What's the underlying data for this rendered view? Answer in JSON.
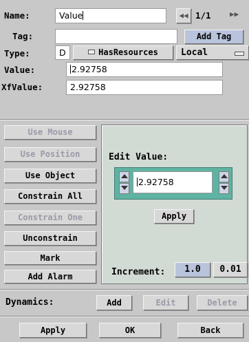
{
  "name": {
    "label": "Name:",
    "value": "Value",
    "pager": "1/1"
  },
  "tag": {
    "label": "Tag:",
    "value": "",
    "add_button": "Add Tag"
  },
  "type": {
    "label": "Type:",
    "code": "D",
    "resources_toggle": "HasResources",
    "scope_select": "Local"
  },
  "value": {
    "label": "Value:",
    "value": "2.92758"
  },
  "xfvalue": {
    "label": "XfValue:",
    "value": "2.92758"
  },
  "side_buttons": [
    {
      "label": "Use Mouse",
      "enabled": false
    },
    {
      "label": "Use Position",
      "enabled": false
    },
    {
      "label": "Use Object",
      "enabled": true
    },
    {
      "label": "Constrain All",
      "enabled": true
    },
    {
      "label": "Constrain One",
      "enabled": false
    },
    {
      "label": "Unconstrain",
      "enabled": true
    },
    {
      "label": "Mark",
      "enabled": true
    },
    {
      "label": "Add Alarm",
      "enabled": true
    }
  ],
  "edit": {
    "title": "Edit Value:",
    "value": "2.92758",
    "apply": "Apply",
    "increment_label": "Increment:",
    "increment_values": [
      "1.0",
      "0.01"
    ],
    "selected_increment": "1.0"
  },
  "dynamics": {
    "label": "Dynamics:",
    "add": "Add",
    "edit": "Edit",
    "delete": "Delete"
  },
  "footer": {
    "apply": "Apply",
    "ok": "OK",
    "back": "Back"
  },
  "colors": {
    "window_bg": "#c8c8c8",
    "edit_panel_bg": "#d2dad4",
    "spin_box_bg": "#5fb3a3",
    "field_bg": "#ffffff",
    "increment_selected_bg": "#b9c3dc",
    "disabled_text": "#9a9aa8"
  }
}
